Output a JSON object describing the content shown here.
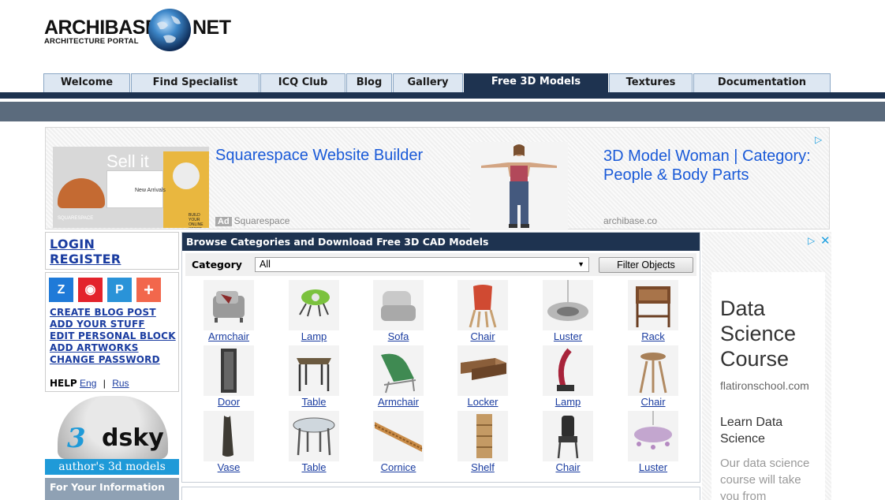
{
  "logo": {
    "word1": "ARCHIBASE",
    "word2": "NET",
    "subtitle": "ARCHITECTURE PORTAL"
  },
  "nav": {
    "tabs": [
      {
        "label": "Welcome"
      },
      {
        "label": "Find Specialist"
      },
      {
        "label": "ICQ Club"
      },
      {
        "label": "Blog"
      },
      {
        "label": "Gallery"
      },
      {
        "label": "Free 3D Models",
        "active": true
      },
      {
        "label": "Textures"
      },
      {
        "label": "Documentation"
      }
    ],
    "colors": {
      "active_bg": "#1e3350",
      "tab_bg": "#dde7f2",
      "bar": "#5b6b7d"
    }
  },
  "top_ad": {
    "image_text": {
      "headline": "Sell it",
      "card": "New Arrivals",
      "brand": "SQUARESPACE",
      "cta": "BUILD YOUR ONLINE STORE"
    },
    "ad1_title": "Squarespace Website Builder",
    "ad1_badge": "Ad",
    "ad1_source": "Squarespace",
    "ad2_title": "3D Model Woman | Category: People & Body Parts",
    "ad2_source": "archibase.co"
  },
  "left": {
    "login": "LOGIN",
    "register": "REGISTER",
    "social_icons": [
      "zotero-icon",
      "weibo-icon",
      "pinboard-icon",
      "plus-icon"
    ],
    "links": [
      "CREATE BLOG POST",
      "ADD YOUR STUFF",
      "EDIT PERSONAL BLOCK",
      "ADD ARTWORKS",
      "CHANGE PASSWORD"
    ],
    "help_label": "HELP",
    "help_eng": "Eng",
    "help_sep": "|",
    "help_rus": "Rus",
    "dsky": {
      "brand_a": "3",
      "brand_b": "dsky",
      "strip": "author's 3d models"
    },
    "fyi": "For Your Information"
  },
  "panel": {
    "title": "Browse Categories and Download Free 3D CAD Models",
    "category_label": "Category",
    "category_value": "All",
    "filter_button": "Filter Objects",
    "items": [
      [
        "Armchair",
        "Lamp",
        "Sofa",
        "Chair",
        "Luster",
        "Rack"
      ],
      [
        "Door",
        "Table",
        "Armchair",
        "Locker",
        "Lamp",
        "Chair"
      ],
      [
        "Vase",
        "Table",
        "Cornice",
        "Shelf",
        "Chair",
        "Luster"
      ]
    ]
  },
  "right_ad": {
    "title": "Data Science Course",
    "domain": "flatironschool.com",
    "subtitle": "Learn Data Science",
    "body": "Our data science course will take you from"
  }
}
